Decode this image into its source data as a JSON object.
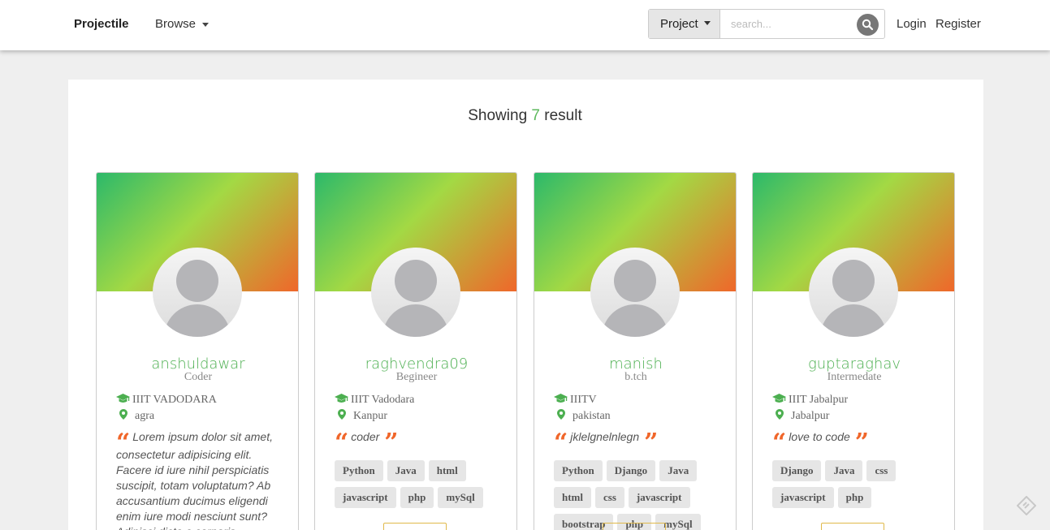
{
  "navbar": {
    "brand": "Projectile",
    "browse_label": "Browse",
    "project_label": "Project",
    "search_placeholder": "search...",
    "login_label": "Login",
    "register_label": "Register"
  },
  "results": {
    "prefix": "Showing",
    "count": "7",
    "suffix": "result"
  },
  "cards": [
    {
      "name": "anshuldawar",
      "role": "Coder",
      "college": "IIIT VADODARA",
      "city": "agra",
      "quote": "Lorem ipsum dolor sit amet, consectetur adipisicing elit. Facere id iure nihil perspiciatis suscipit, totam voluptatum? Ab accusantium ducimus eligendi enim iure modi nesciunt sunt? Adipisci dicta a corporis",
      "tags": []
    },
    {
      "name": "raghvendra09",
      "role": "Begineer",
      "college": "IIIT Vadodara",
      "city": "Kanpur",
      "quote": "coder",
      "tags": [
        "Python",
        "Java",
        "html",
        "javascript",
        "php",
        "mySql"
      ]
    },
    {
      "name": "manish",
      "role": "b.tch",
      "college": "IIITV",
      "city": "pakistan",
      "quote": "jklelgnelnlegn",
      "tags": [
        "Python",
        "Django",
        "Java",
        "html",
        "css",
        "javascript",
        "bootstrap",
        "php",
        "mySql"
      ]
    },
    {
      "name": "guptaraghav",
      "role": "Intermedate",
      "college": "IIIT Jabalpur",
      "city": "Jabalpur",
      "quote": "love to code",
      "tags": [
        "Django",
        "Java",
        "css",
        "javascript",
        "php"
      ]
    }
  ],
  "colors": {
    "accent_green": "#4caf50",
    "quote_orange": "#f0662a",
    "gradient": [
      "#2cb96a",
      "#a3d944",
      "#f0662a"
    ]
  }
}
